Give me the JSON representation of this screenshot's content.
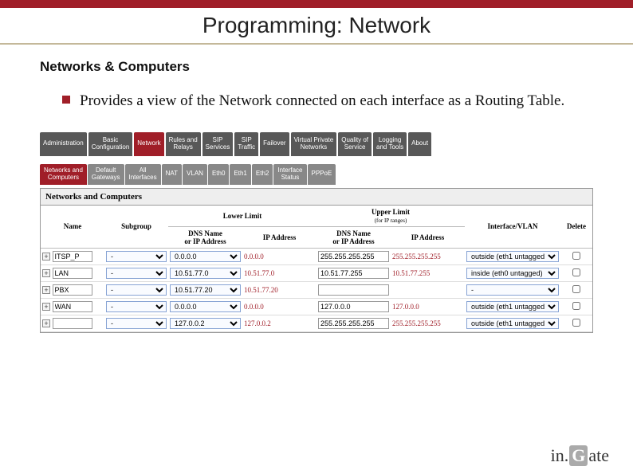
{
  "title": "Programming: Network",
  "subtitle": "Networks & Computers",
  "bullet_text": "Provides a view of the Network connected on each interface as a Routing Table.",
  "tabs_main": [
    "Administration",
    "Basic\nConfiguration",
    "Network",
    "Rules and\nRelays",
    "SIP\nServices",
    "SIP\nTraffic",
    "Failover",
    "Virtual Private\nNetworks",
    "Quality of\nService",
    "Logging\nand Tools",
    "About"
  ],
  "tabs_sub": [
    "Networks and\nComputers",
    "Default\nGateways",
    "All\nInterfaces",
    "NAT",
    "VLAN",
    "Eth0",
    "Eth1",
    "Eth2",
    "Interface\nStatus",
    "PPPoE"
  ],
  "panel_title": "Networks and Computers",
  "headers": {
    "name": "Name",
    "subgroup": "Subgroup",
    "lower": "Lower Limit",
    "upper": "Upper Limit",
    "upper_note": "(for IP ranges)",
    "dns": "DNS Name\nor IP Address",
    "ip": "IP Address",
    "iface": "Interface/VLAN",
    "del": "Delete"
  },
  "rows": [
    {
      "name": "ITSP_P",
      "sub": "-",
      "dns_l": "0.0.0.0",
      "ip_l": "0.0.0.0",
      "dns_u": "255.255.255.255",
      "ip_u": "255.255.255.255",
      "iface": "outside (eth1 untagged)",
      "chk": false
    },
    {
      "name": "LAN",
      "sub": "-",
      "dns_l": "10.51.77.0",
      "ip_l": "10.51.77.0",
      "dns_u": "10.51.77.255",
      "ip_u": "10.51.77.255",
      "iface": "inside (eth0 untagged)",
      "chk": false
    },
    {
      "name": "PBX",
      "sub": "-",
      "dns_l": "10.51.77.20",
      "ip_l": "10.51.77.20",
      "dns_u": "",
      "ip_u": "",
      "iface": "-",
      "chk": false
    },
    {
      "name": "WAN",
      "sub": "-",
      "dns_l": "0.0.0.0",
      "ip_l": "0.0.0.0",
      "dns_u": "127.0.0.0",
      "ip_u": "127.0.0.0",
      "iface": "outside (eth1 untagged)",
      "chk": false
    },
    {
      "name": "",
      "sub": "-",
      "dns_l": "127.0.0.2",
      "ip_l": "127.0.0.2",
      "dns_u": "255.255.255.255",
      "ip_u": "255.255.255.255",
      "iface": "outside (eth1 untagged)",
      "chk": false
    }
  ],
  "logo": {
    "pre": "in.",
    "g": "G",
    "post": "ate"
  }
}
